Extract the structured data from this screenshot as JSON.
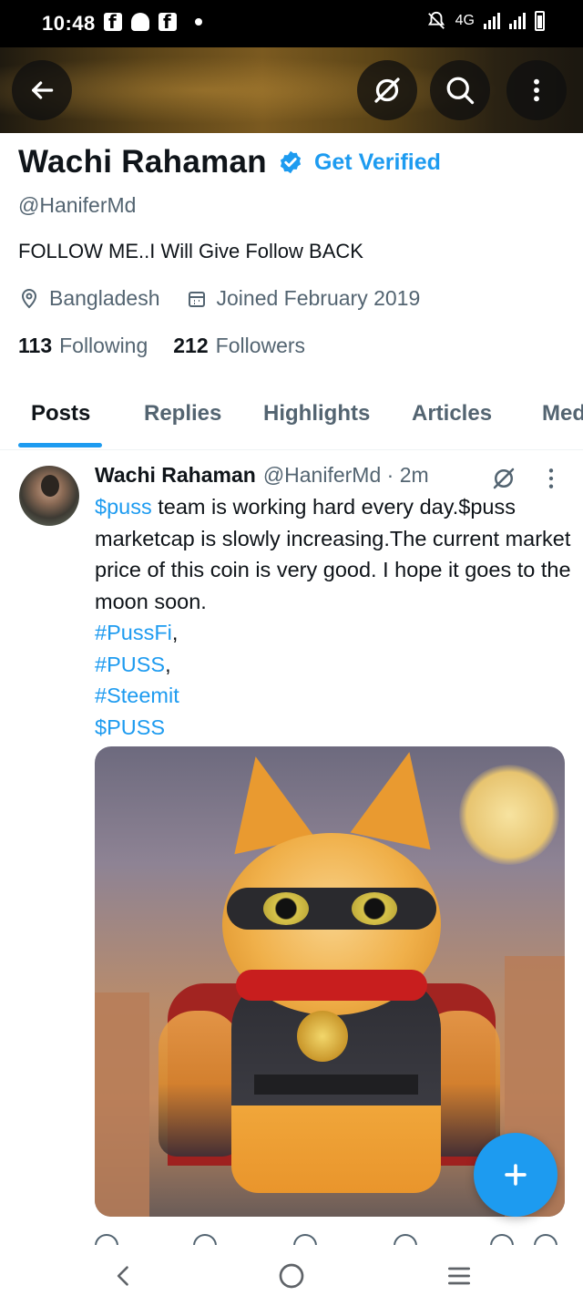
{
  "status_bar": {
    "time": "10:48",
    "network": "4G"
  },
  "header": {
    "back_icon": "arrow-left-icon",
    "grok_icon": "grok-icon",
    "search_icon": "search-icon",
    "more_icon": "more-vertical-icon"
  },
  "profile": {
    "display_name": "Wachi Rahaman",
    "get_verified_label": "Get Verified",
    "handle": "@HaniferMd",
    "bio": "FOLLOW ME..I Will Give Follow BACK",
    "location": "Bangladesh",
    "joined": "Joined February 2019",
    "following_count": "113",
    "following_label": "Following",
    "followers_count": "212",
    "followers_label": "Followers"
  },
  "tabs": [
    {
      "label": "Posts"
    },
    {
      "label": "Replies"
    },
    {
      "label": "Highlights"
    },
    {
      "label": "Articles"
    },
    {
      "label": "Med"
    }
  ],
  "post": {
    "author": "Wachi Rahaman",
    "handle_time": "@HaniferMd · 2m",
    "text_link_1": "$puss",
    "text_1": " team is working hard every day.$puss marketcap is slowly increasing.The current market price of this coin is very good. I hope it goes to the moon soon.",
    "hashtags": [
      {
        "tag": "#PussFi",
        "suffix": ","
      },
      {
        "tag": "#PUSS",
        "suffix": ","
      },
      {
        "tag": "#Steemit",
        "suffix": ""
      },
      {
        "tag": "$PUSS",
        "suffix": ""
      }
    ]
  },
  "colors": {
    "accent": "#1d9bf0",
    "text_primary": "#0f1419",
    "text_secondary": "#536471"
  }
}
